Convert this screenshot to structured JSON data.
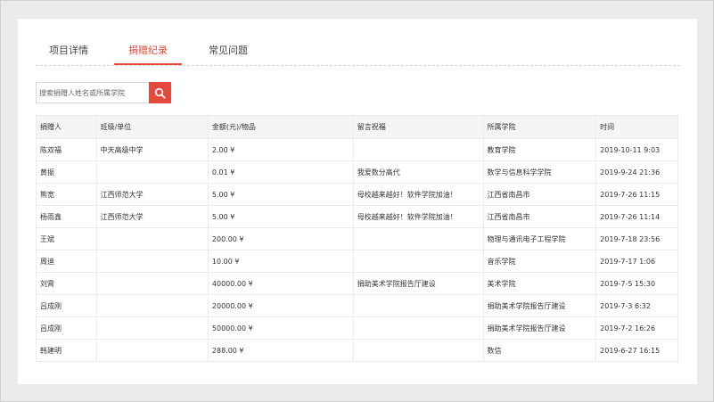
{
  "tabs": [
    {
      "label": "项目详情",
      "active": false
    },
    {
      "label": "捐赠纪录",
      "active": true
    },
    {
      "label": "常见问题",
      "active": false
    }
  ],
  "search": {
    "placeholder": "搜索捐赠人姓名或所属学院",
    "value": "",
    "icon": "search-icon",
    "button_color": "#e4493c"
  },
  "accent_color": "#e4493c",
  "table": {
    "headers": [
      "捐赠人",
      "班级/单位",
      "金额(元)/物品",
      "留言祝福",
      "所属学院",
      "时间"
    ],
    "rows": [
      [
        "陈双福",
        "中天高级中学",
        "2.00 ¥",
        "",
        "教育学院",
        "2019-10-11 9:03"
      ],
      [
        "黄振",
        "",
        "0.01 ¥",
        "我爱数分高代",
        "数学与信息科学学院",
        "2019-9-24 21:36"
      ],
      [
        "熊宽",
        "江西师范大学",
        "5.00 ¥",
        "母校越来越好！软件学院加油！",
        "江西省南昌市",
        "2019-7-26 11:15"
      ],
      [
        "杨雨鑫",
        "江西师范大学",
        "5.00 ¥",
        "母校越来越好！软件学院加油！",
        "江西省南昌市",
        "2019-7-26 11:14"
      ],
      [
        "王斌",
        "",
        "200.00 ¥",
        "",
        "物理与通讯电子工程学院",
        "2019-7-18 23:56"
      ],
      [
        "周迪",
        "",
        "10.00 ¥",
        "",
        "音乐学院",
        "2019-7-17 1:06"
      ],
      [
        "刘霄",
        "",
        "40000.00 ¥",
        "捐助美术学院报告厅建设",
        "美术学院",
        "2019-7-5 15:30"
      ],
      [
        "吕成刚",
        "",
        "20000.00 ¥",
        "",
        "捐助美术学院报告厅建设",
        "2019-7-3 6:32"
      ],
      [
        "吕成刚",
        "",
        "50000.00 ¥",
        "",
        "捐助美术学院报告厅建设",
        "2019-7-2 16:26"
      ],
      [
        "韩建明",
        "",
        "288.00 ¥",
        "",
        "数信",
        "2019-6-27 16:15"
      ]
    ]
  }
}
